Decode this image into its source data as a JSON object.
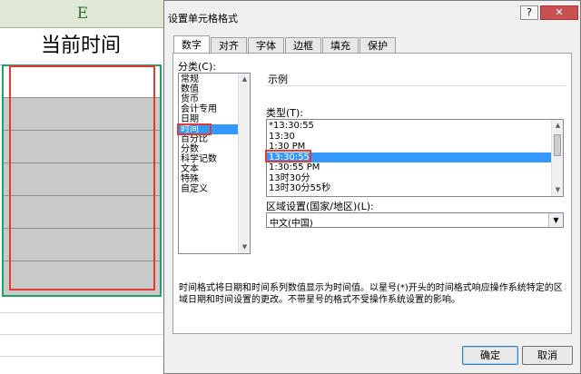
{
  "sheet": {
    "column_letter": "E",
    "header_cell": "当前时间"
  },
  "dialog": {
    "title": "设置单元格格式",
    "help_button": "?",
    "close_button": "✕",
    "tabs": [
      {
        "label": "数字",
        "active": true
      },
      {
        "label": "对齐",
        "active": false
      },
      {
        "label": "字体",
        "active": false
      },
      {
        "label": "边框",
        "active": false
      },
      {
        "label": "填充",
        "active": false
      },
      {
        "label": "保护",
        "active": false
      }
    ],
    "category_label": "分类(C):",
    "categories": [
      "常规",
      "数值",
      "货币",
      "会计专用",
      "日期",
      "时间",
      "百分比",
      "分数",
      "科学记数",
      "文本",
      "特殊",
      "自定义"
    ],
    "selected_category": "时间",
    "sample_label": "示例",
    "type_label": "类型(T):",
    "types": [
      "*13:30:55",
      "13:30",
      "1:30 PM",
      "13:30:55",
      "1:30:55 PM",
      "13时30分",
      "13时30分55秒"
    ],
    "selected_type": "13:30:55",
    "locale_label": "区域设置(国家/地区)(L):",
    "locale_value": "中文(中国)",
    "description": "时间格式将日期和时间系列数值显示为时间值。以星号(*)开头的时间格式响应操作系统特定的区域日期和时间设置的更改。不带星号的格式不受操作系统设置的影响。",
    "ok_button": "确定",
    "cancel_button": "取消"
  },
  "colors": {
    "selection": "#3399ff",
    "annotation_red": "#e53935",
    "excel_selection": "#21a366"
  }
}
